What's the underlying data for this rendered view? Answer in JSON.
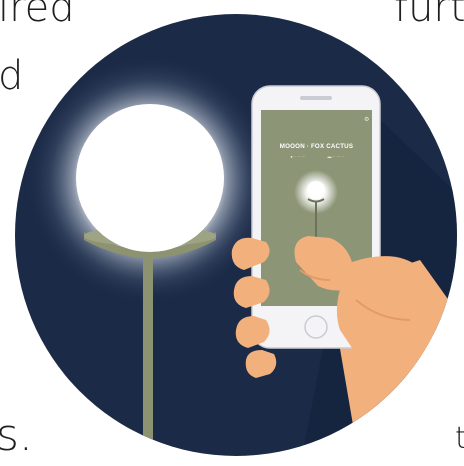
{
  "background_text": {
    "top_left": "ired",
    "top_right": "furt",
    "mid_left": "d",
    "bottom_left": "s.",
    "bottom_right": "t"
  },
  "phone_screen": {
    "header": "",
    "title": "MOOON · FOX CACTUS",
    "sub_left": "● ·· ······",
    "sub_right": "▬ ·· ······"
  },
  "colors": {
    "circle_bg": "#1a2a47",
    "lamp_glow": "#ffffff",
    "lamp_base": "#8d9270",
    "lamp_pole": "#8d9270",
    "phone_body": "#f4f4f6",
    "phone_screen": "#8c9576",
    "skin": "#f2b07d",
    "skin_shadow": "#e49a66"
  },
  "icons": {
    "lamp": "lamp-illustration",
    "phone": "smartphone-illustration",
    "hand": "hand-illustration"
  }
}
